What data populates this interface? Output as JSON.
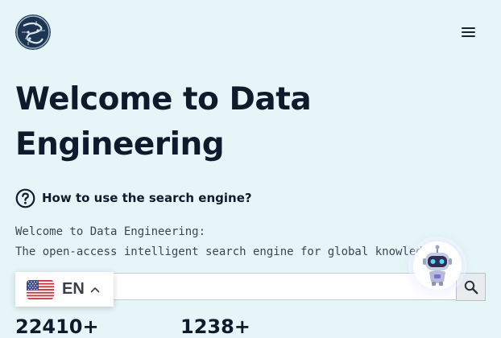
{
  "header": {
    "logo_icon": "circuit-brain-logo",
    "menu_icon": "hamburger-menu-icon"
  },
  "hero": {
    "title_line1": "Welcome to Data",
    "title_line2": "Engineering"
  },
  "howto": {
    "icon": "question-circle-icon",
    "label": "How to use the search engine?"
  },
  "intro": {
    "line1": "Welcome to Data Engineering:",
    "line2": "The open-access intelligent search engine for global knowledge."
  },
  "search": {
    "value": "",
    "placeholder": "",
    "button_icon": "search-icon"
  },
  "language": {
    "flag_icon": "us-flag-icon",
    "code": "EN",
    "chevron_icon": "chevron-up-icon"
  },
  "chatbot": {
    "icon": "robot-icon"
  },
  "stats": [
    {
      "value": "22410+"
    },
    {
      "value": "1238+"
    }
  ],
  "colors": {
    "background": "#e6f6f8",
    "title": "#0f1b2d",
    "body_text": "#3a4656"
  }
}
